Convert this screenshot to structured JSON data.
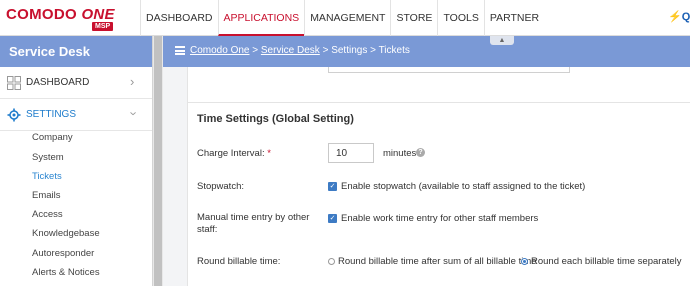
{
  "logo": {
    "main": "COMODO",
    "one": "ONE",
    "badge": "MSP"
  },
  "nav": {
    "items": [
      "DASHBOARD",
      "APPLICATIONS",
      "MANAGEMENT",
      "STORE",
      "TOOLS",
      "PARTNER"
    ],
    "active": "APPLICATIONS",
    "quick_label": "Q"
  },
  "sidebar": {
    "title": "Service Desk",
    "menus": [
      {
        "label": "DASHBOARD",
        "icon": "grid-icon"
      },
      {
        "label": "SETTINGS",
        "icon": "gear-icon"
      }
    ],
    "sub_items": [
      "Company",
      "System",
      "Tickets",
      "Emails",
      "Access",
      "Knowledgebase",
      "Autoresponder",
      "Alerts & Notices"
    ],
    "active_sub": "Tickets"
  },
  "breadcrumb": {
    "items": [
      "Comodo One",
      "Service Desk",
      "Settings",
      "Tickets"
    ],
    "sep": " > "
  },
  "section": {
    "title": "Time Settings (Global Setting)"
  },
  "form": {
    "charge_interval": {
      "label": "Charge Interval:",
      "required": "*",
      "value": "10",
      "unit": "minutes"
    },
    "stopwatch": {
      "label": "Stopwatch:",
      "checkbox_label": "Enable stopwatch (available to staff assigned to the ticket)",
      "checked": true
    },
    "manual_entry": {
      "label_line1": "Manual time entry by other",
      "label_line2": "staff:",
      "checkbox_label": "Enable work time entry for other staff members",
      "checked": true
    },
    "round_billable": {
      "label": "Round billable time:",
      "options": [
        "Round billable time after sum of all billable time",
        "Round each billable time separately"
      ],
      "selected": "Round each billable time separately"
    }
  },
  "colors": {
    "brand": "#c8102e",
    "header_blue": "#7a99d6",
    "link_blue": "#2a85d0",
    "checkbox_blue": "#3d7bc4"
  }
}
